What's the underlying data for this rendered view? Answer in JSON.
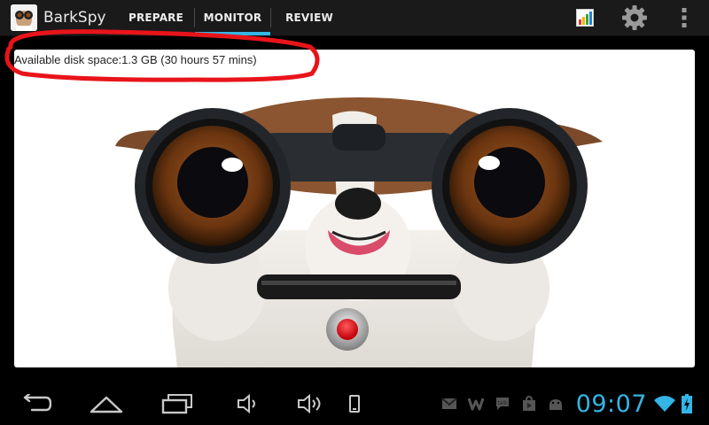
{
  "app": {
    "title": "BarkSpy"
  },
  "tabs": [
    {
      "label": "PREPARE",
      "selected": false
    },
    {
      "label": "MONITOR",
      "selected": true
    },
    {
      "label": "REVIEW",
      "selected": false
    }
  ],
  "actions": {
    "icons": [
      "stats-icon",
      "settings-icon",
      "overflow-menu-icon"
    ]
  },
  "main": {
    "disk_space_text": "Available disk space:1.3 GB (30 hours 57 mins)",
    "highlight_color": "#e8141a"
  },
  "statusbar": {
    "time": "09:07",
    "accent_color": "#33b5e5",
    "notification_icons": [
      "gmail-icon",
      "w-app-icon",
      "talk-icon",
      "store-icon",
      "android-icon"
    ]
  },
  "colors": {
    "tab_indicator": "#33b5e5",
    "record": "#e0141c"
  }
}
